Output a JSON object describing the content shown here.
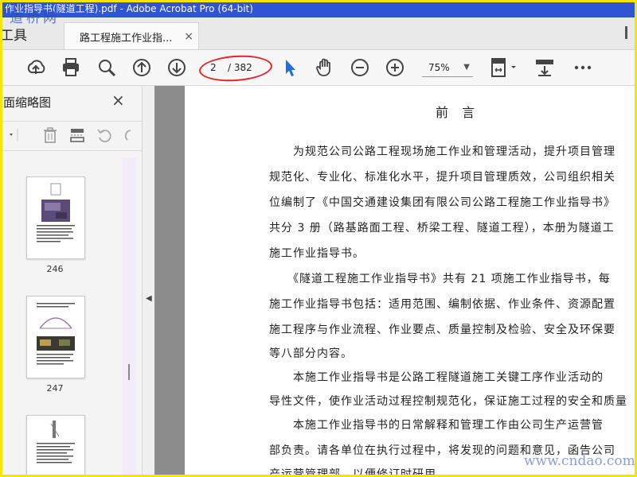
{
  "window": {
    "title": "作业指导书(隧道工程).pdf - Adobe Acrobat Pro (64-bit)"
  },
  "watermark": {
    "top": "道桥网",
    "bottom": "www.cndao.com"
  },
  "tabs": {
    "tools_label": "工具",
    "doc_tab_label": "路工程施工作业指...",
    "close_glyph": "×"
  },
  "toolbar": {
    "page_current": "2",
    "page_total": "/ 382",
    "zoom": "75%",
    "icons": [
      "upload-icon",
      "print-icon",
      "zoom-search-icon",
      "page-up-icon",
      "page-down-icon",
      "select-arrow-icon",
      "hand-icon",
      "zoom-out-icon",
      "zoom-in-icon",
      "fit-page-icon",
      "scroll-mode-icon",
      "more-icon"
    ]
  },
  "sidebar": {
    "title": "面缩略图",
    "close_glyph": "×",
    "thumbnails": [
      {
        "page": "246"
      },
      {
        "page": "247"
      },
      {
        "page": ""
      }
    ]
  },
  "document": {
    "heading": "前  言",
    "lines": [
      "　　为规范公司公路工程现场施工作业和管理活动，提升项目管理",
      "规范化、专业化、标准化水平，提升项目管理质效，公司组织相关",
      "位编制了《中国交通建设集团有限公司公路工程施工作业指导书》",
      "共分 3 册（路基路面工程、桥梁工程、隧道工程），本册为隧道工",
      "施工作业指导书。",
      "　　《隧道工程施工作业指导书》共有 21 项施工作业指导书，每",
      "施工作业指导书包括：适用范围、编制依据、作业条件、资源配置",
      "施工程序与作业流程、作业要点、质量控制及检验、安全及环保要",
      "等八部分内容。",
      "　　本施工作业指导书是公路工程隧道施工关键工序作业活动的",
      "导性文件，使作业活动过程控制规范化，保证施工过程的安全和质量",
      "　　本施工作业指导书的日常解释和管理工作由公司生产运营管",
      "部负责。请各单位在执行过程中，将发现的问题和意见，函告公司",
      "产运营管理部，以便修订时研用。"
    ]
  },
  "colors": {
    "titlebar": "#2f54d6",
    "frame": "#f3e600",
    "highlight": "#e32626",
    "select_tool": "#1f6fe0"
  }
}
